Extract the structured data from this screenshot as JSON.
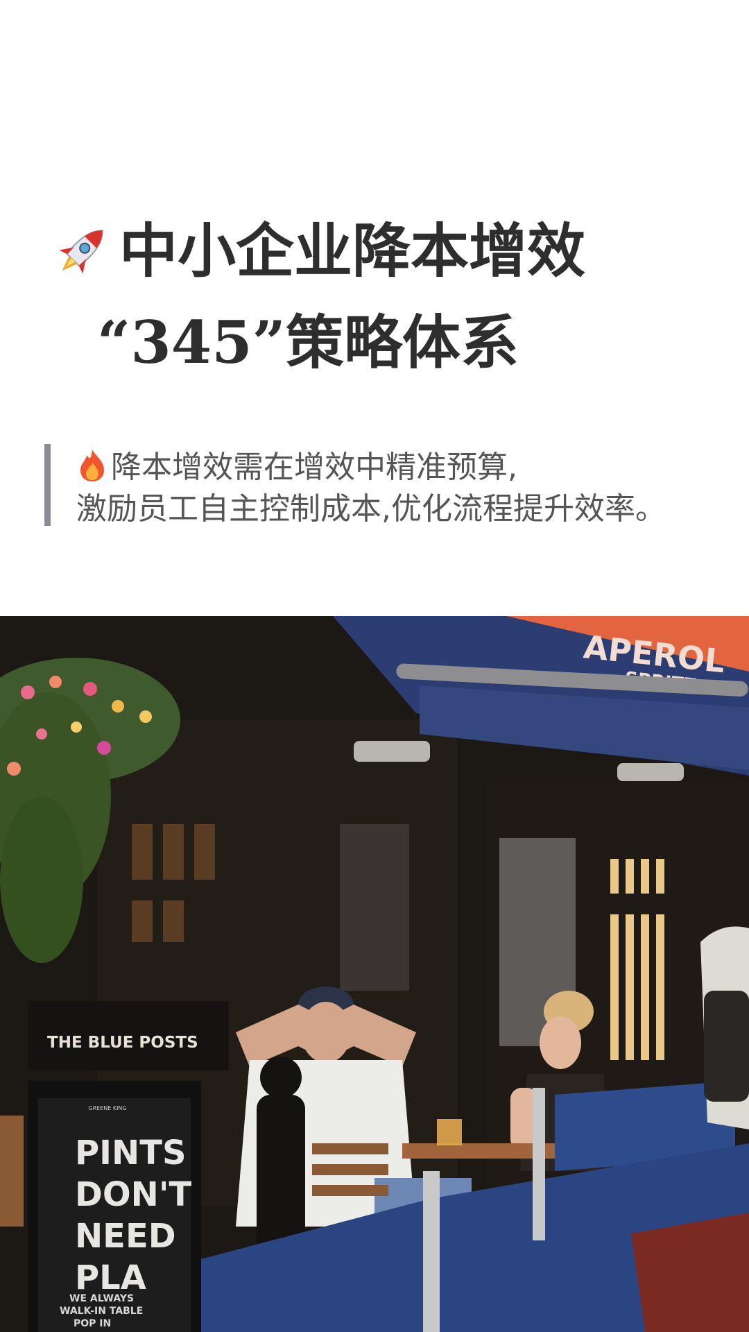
{
  "header": {
    "title_line_1": "中小企业降本增效",
    "title_line_2": "“345”策略体系",
    "title_icon": "rocket-icon"
  },
  "quote": {
    "icon": "fire-icon",
    "line_1": "降本增效需在增效中精准预算,",
    "line_2": "激励员工自主控制成本,优化流程提升效率。",
    "bar_color": "#8a8a99"
  },
  "photo": {
    "awning_brand": "APEROL",
    "awning_sub": "SPRITZ",
    "pub_sign": "THE BLUE POSTS",
    "board_lines": [
      "PINTS",
      "DON'T",
      "NEED",
      "PLA"
    ],
    "board_small": [
      "WE ALWAYS",
      "WALK-IN TABLE",
      "POP IN"
    ],
    "board_brand": "GREENE KING"
  },
  "colors": {
    "title": "#2e2e2e",
    "text": "#555555",
    "awning_blue": "#2b3d73",
    "awning_orange": "#e2653f"
  }
}
